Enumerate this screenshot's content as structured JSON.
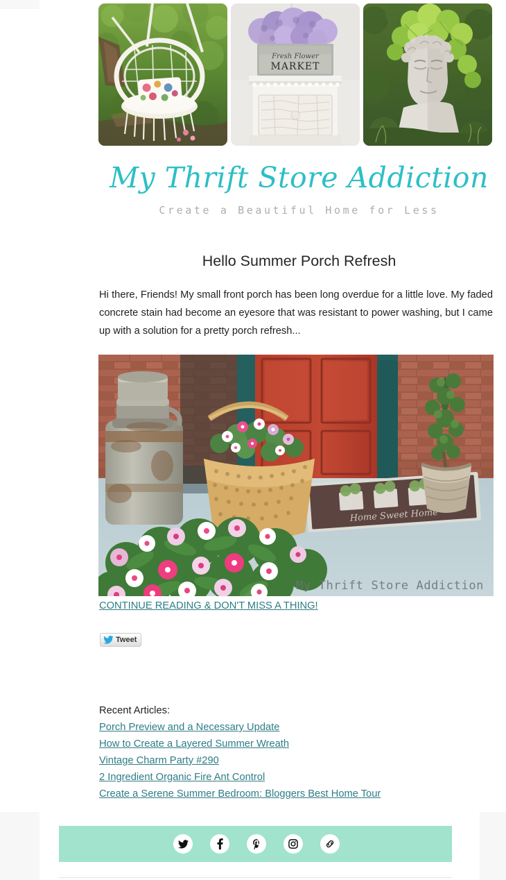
{
  "brand": {
    "title": "My Thrift Store Addiction",
    "tagline": "Create a Beautiful Home for Less",
    "accent_color": "#2cbfc6",
    "link_color": "#2e7d86",
    "mint_color": "#a1e3cd"
  },
  "hero": {
    "images": [
      {
        "name": "macrame-hanging-chair-garden",
        "alt": "White macrame hanging chair with floral pillow in a leafy garden"
      },
      {
        "name": "fresh-flower-market-sign",
        "alt": "Fresh Flower Market metal sign with purple hydrangeas on a white distressed nightstand",
        "sign_line1": "Fresh Flower",
        "sign_line2": "MARKET"
      },
      {
        "name": "face-planter-with-ivy",
        "alt": "White concrete face planter with green ivy growing on top in a garden"
      }
    ]
  },
  "post": {
    "title": "Hello Summer Porch Refresh",
    "body": "Hi there, Friends!  My small front porch has been long overdue for a little love. My faded concrete stain had become an eyesore that was resistant to power washing, but I came up with a solution for a pretty porch refresh...",
    "photo": {
      "name": "front-porch-red-door-flower-basket",
      "alt": "Front porch with red door, teal trim, brick wall, rusty milk can, wicker basket of pink and white flowers and a Home Sweet Home doormat",
      "watermark": "My Thrift Store Addiction",
      "doormat_text": "Home Sweet Home"
    },
    "continue_link": "CONTINUE READING & DON'T MISS A THING!"
  },
  "share": {
    "tweet_label": "Tweet"
  },
  "recent": {
    "label": "Recent Articles:",
    "items": [
      "Porch Preview and a Necessary Update",
      "How to Create a Layered Summer Wreath",
      "Vintage Charm Party #290",
      "2 Ingredient Organic Fire Ant Control",
      "Create a Serene Summer Bedroom: Bloggers Best Home Tour"
    ]
  },
  "social": {
    "items": [
      {
        "icon": "twitter-icon",
        "label": "Twitter"
      },
      {
        "icon": "facebook-icon",
        "label": "Facebook"
      },
      {
        "icon": "pinterest-icon",
        "label": "Pinterest"
      },
      {
        "icon": "instagram-icon",
        "label": "Instagram"
      },
      {
        "icon": "link-icon",
        "label": "Website"
      }
    ]
  }
}
